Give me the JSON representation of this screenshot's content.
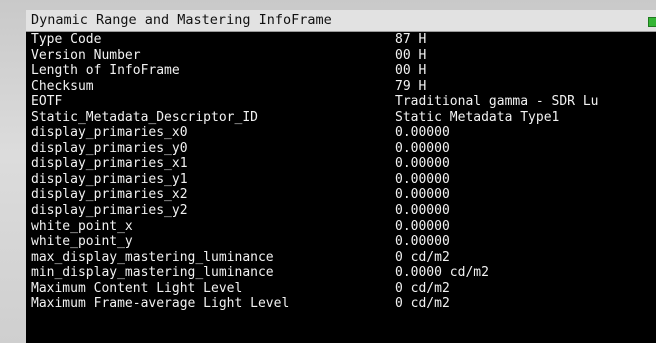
{
  "window": {
    "title": "Dynamic Range and Mastering InfoFrame",
    "status_color": "#35b535"
  },
  "rows": [
    {
      "label": "Type Code",
      "value": "87 H"
    },
    {
      "label": "Version Number",
      "value": "00 H"
    },
    {
      "label": "Length of InfoFrame",
      "value": "00 H"
    },
    {
      "label": "Checksum",
      "value": "79 H"
    },
    {
      "label": "EOTF",
      "value": "Traditional gamma - SDR Lu"
    },
    {
      "label": "Static_Metadata_Descriptor_ID",
      "value": "Static Metadata Type1"
    },
    {
      "label": "display_primaries_x0",
      "value": "0.00000"
    },
    {
      "label": "display_primaries_y0",
      "value": "0.00000"
    },
    {
      "label": "display_primaries_x1",
      "value": "0.00000"
    },
    {
      "label": "display_primaries_y1",
      "value": "0.00000"
    },
    {
      "label": "display_primaries_x2",
      "value": "0.00000"
    },
    {
      "label": "display_primaries_y2",
      "value": "0.00000"
    },
    {
      "label": "white_point_x",
      "value": "0.00000"
    },
    {
      "label": "white_point_y",
      "value": "0.00000"
    },
    {
      "label": "max_display_mastering_luminance",
      "value": "0 cd/m2"
    },
    {
      "label": "min_display_mastering_luminance",
      "value": "0.0000 cd/m2"
    },
    {
      "label": "Maximum Content Light Level",
      "value": "0 cd/m2"
    },
    {
      "label": "Maximum Frame-average Light Level",
      "value": "0 cd/m2"
    }
  ]
}
